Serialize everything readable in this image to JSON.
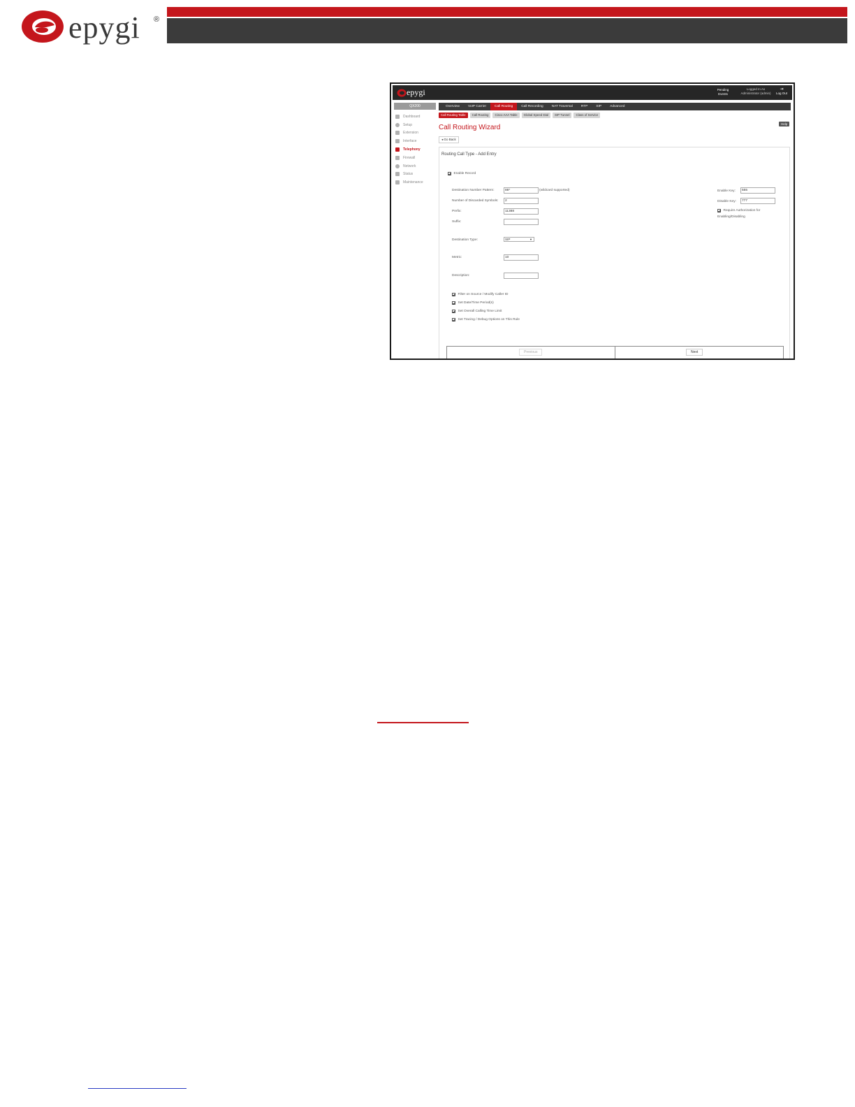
{
  "doc": {
    "brand": "epygi",
    "reg_mark": "®"
  },
  "app": {
    "brand": "epygi",
    "pending_events": "Pending Events",
    "logged_in_as_label": "Logged In As",
    "logged_in_user": "Administrator (admin)",
    "logout_label": "Log Out",
    "model": "QX200",
    "main_tabs": [
      {
        "label": "Overview",
        "active": false
      },
      {
        "label": "VoIP Carrier",
        "active": false
      },
      {
        "label": "Call Routing",
        "active": true
      },
      {
        "label": "Call Recording",
        "active": false
      },
      {
        "label": "NAT Traversal",
        "active": false
      },
      {
        "label": "RTP",
        "active": false
      },
      {
        "label": "SIP",
        "active": false
      },
      {
        "label": "Advanced",
        "active": false
      }
    ],
    "sidebar": [
      {
        "label": "Dashboard",
        "icon": "dashboard-icon",
        "active": false
      },
      {
        "label": "Setup",
        "icon": "gear-icon",
        "active": false
      },
      {
        "label": "Extension",
        "icon": "extension-icon",
        "active": false
      },
      {
        "label": "Interface",
        "icon": "interface-icon",
        "active": false
      },
      {
        "label": "Telephony",
        "icon": "phone-icon",
        "active": true
      },
      {
        "label": "Firewall",
        "icon": "firewall-icon",
        "active": false
      },
      {
        "label": "Network",
        "icon": "globe-icon",
        "active": false
      },
      {
        "label": "Status",
        "icon": "status-icon",
        "active": false
      },
      {
        "label": "Maintenance",
        "icon": "wrench-icon",
        "active": false
      }
    ],
    "sub_tabs": [
      {
        "label": "Call Routing Table",
        "active": true
      },
      {
        "label": "Call Routing",
        "active": false
      },
      {
        "label": "Cisco AAA Table",
        "active": false
      },
      {
        "label": "Global Speed Dial",
        "active": false
      },
      {
        "label": "SIP Tunnel",
        "active": false
      },
      {
        "label": "Class of Service",
        "active": false
      }
    ],
    "wizard_title": "Call Routing Wizard",
    "help_label": "Help",
    "go_back_label": "Go Back",
    "panel_title": "Routing Call Type - Add Entry",
    "enable_record_label": "Enable Record",
    "fields": {
      "dest_pattern_label": "Destination Number Pattern:",
      "dest_pattern_value": "88*",
      "dest_pattern_hint": "(wildcard supported)",
      "discarded_label": "Number of Discarded Symbols:",
      "discarded_value": "2",
      "prefix_label": "Prefix:",
      "prefix_value": "11388",
      "suffix_label": "Suffix:",
      "suffix_value": "",
      "dest_type_label": "Destination Type:",
      "dest_type_value": "SIP",
      "metric_label": "Metric:",
      "metric_value": "10",
      "description_label": "Description:",
      "description_value": "",
      "enable_key_label": "Enable Key:",
      "enable_key_value": "555",
      "disable_key_label": "Disable Key:",
      "disable_key_value": "777",
      "require_auth_label": "Require Authorization for",
      "require_auth_label2": "Enabling/Disabling"
    },
    "options": [
      "Filter on Source / Modify Caller ID",
      "Set Date/Time Period(s)",
      "Set Overall Calling Time Limit",
      "Set Tracing / Debug Options on This Rule"
    ],
    "previous_label": "Previous",
    "next_label": "Next"
  }
}
